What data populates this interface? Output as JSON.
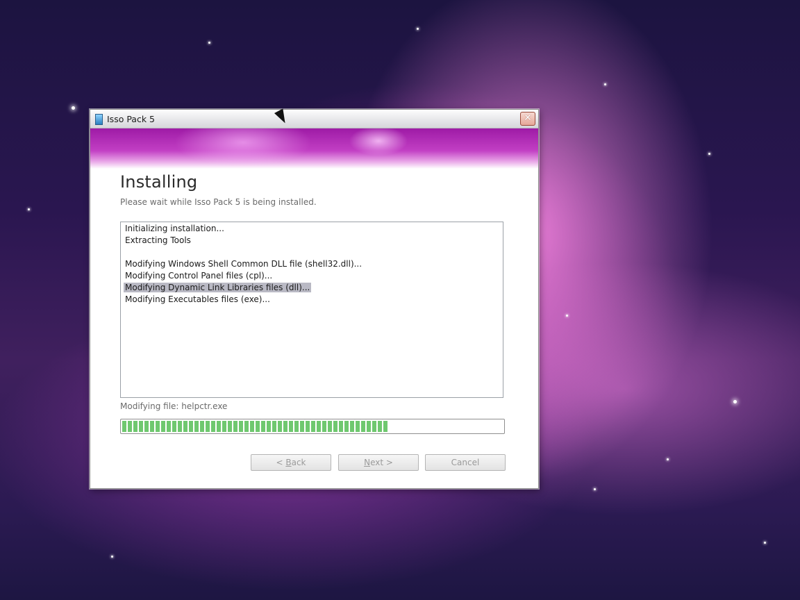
{
  "window": {
    "title": "Isso Pack 5",
    "close_glyph": "✕"
  },
  "page": {
    "heading": "Installing",
    "subheading": "Please wait while Isso Pack 5 is being installed."
  },
  "log": {
    "lines": [
      "Initializing installation...",
      "Extracting Tools",
      "",
      "Modifying Windows Shell Common DLL file (shell32.dll)...",
      "Modifying Control Panel files (cpl)...",
      "Modifying Dynamic Link Libraries files (dll)...",
      "Modifying Executables files (exe)..."
    ],
    "selected_index": 5
  },
  "status": {
    "text": "Modifying file: helpctr.exe",
    "progress_fraction": 0.7
  },
  "buttons": {
    "back_prefix": "< ",
    "back_accel": "B",
    "back_rest": "ack",
    "next_accel": "N",
    "next_rest": "ext >",
    "cancel": "Cancel"
  },
  "colors": {
    "banner": "#b62cb8",
    "progress": "#6fc86f"
  },
  "icons": {
    "app": "installer-icon",
    "close": "close-icon"
  }
}
